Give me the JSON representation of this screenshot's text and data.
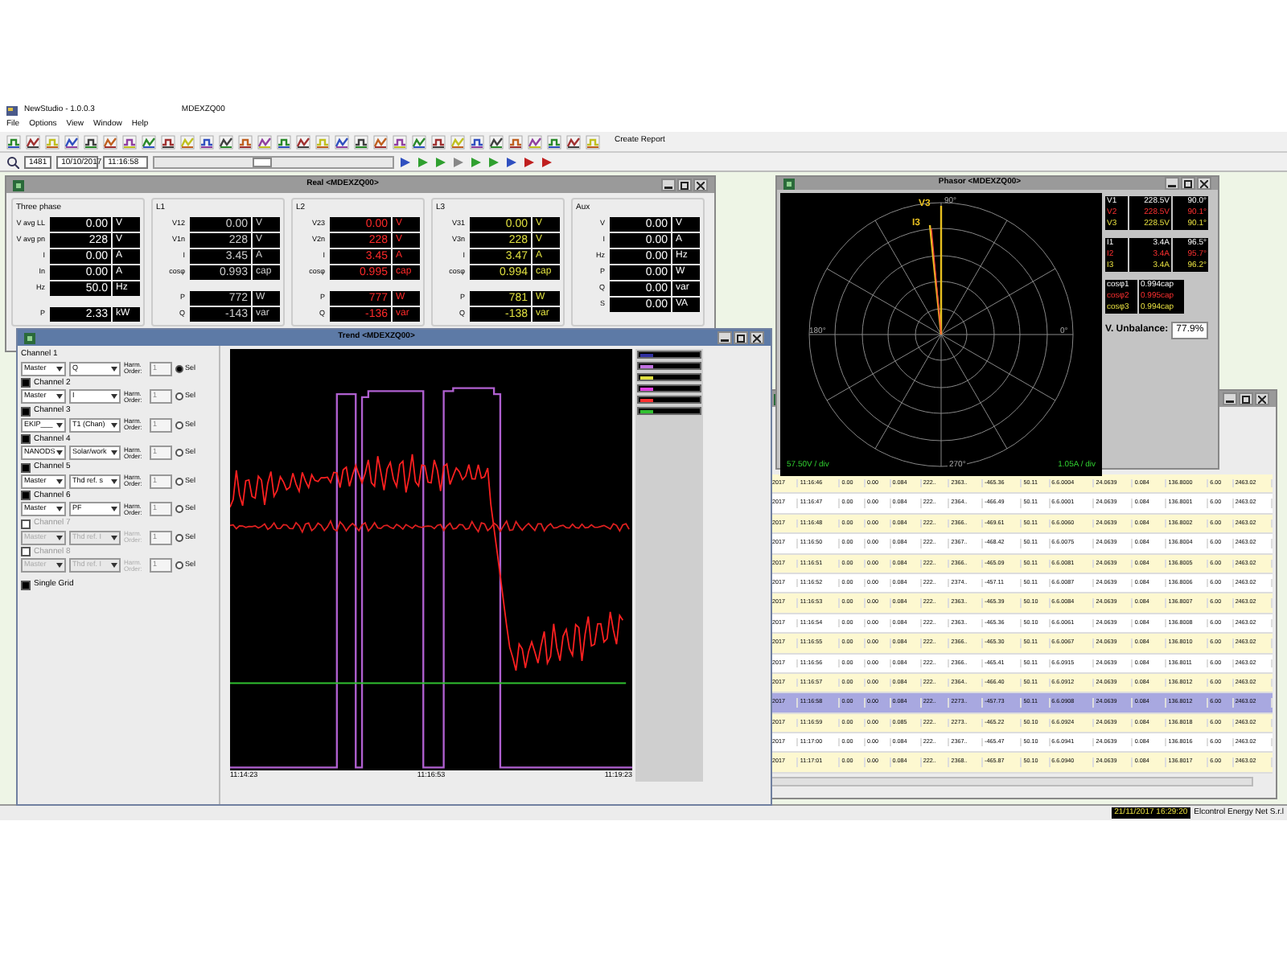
{
  "app": {
    "title": "NewStudio - 1.0.0.3",
    "device": "MDEXZQ00"
  },
  "menu": [
    "File",
    "Options",
    "View",
    "Window",
    "Help"
  ],
  "toolbar": {
    "create_report": "Create Report"
  },
  "navigation": {
    "record": "1481",
    "date": "10/10/2017",
    "time": "11:16:58",
    "level": 0.45
  },
  "real_window": {
    "title": "Real <MDEXZQ00>",
    "groups": [
      {
        "title": "Three phase",
        "kind": "total",
        "blocks": [
          [
            {
              "label": "V avg LL",
              "value": "0.00",
              "unit": "V"
            },
            {
              "label": "V avg pn",
              "value": "228",
              "unit": "V"
            },
            {
              "label": "I",
              "value": "0.00",
              "unit": "A"
            },
            {
              "label": "In",
              "value": "0.00",
              "unit": "A"
            },
            {
              "label": "Hz",
              "value": "50.0",
              "unit": "Hz"
            }
          ],
          [
            {
              "label": "P",
              "value": "2.33",
              "unit": "kW"
            }
          ]
        ]
      },
      {
        "title": "L1",
        "kind": "l1",
        "blocks": [
          [
            {
              "label": "V12",
              "value": "0.00",
              "unit": "V"
            },
            {
              "label": "V1n",
              "value": "228",
              "unit": "V"
            },
            {
              "label": "I",
              "value": "3.45",
              "unit": "A"
            },
            {
              "label": "cosφ",
              "value": "0.993",
              "unit": "cap"
            }
          ],
          [
            {
              "label": "P",
              "value": "772",
              "unit": "W"
            },
            {
              "label": "Q",
              "value": "-143",
              "unit": "var"
            }
          ]
        ]
      },
      {
        "title": "L2",
        "kind": "l2",
        "blocks": [
          [
            {
              "label": "V23",
              "value": "0.00",
              "unit": "V"
            },
            {
              "label": "V2n",
              "value": "228",
              "unit": "V"
            },
            {
              "label": "I",
              "value": "3.45",
              "unit": "A"
            },
            {
              "label": "cosφ",
              "value": "0.995",
              "unit": "cap"
            }
          ],
          [
            {
              "label": "P",
              "value": "777",
              "unit": "W"
            },
            {
              "label": "Q",
              "value": "-136",
              "unit": "var"
            }
          ]
        ]
      },
      {
        "title": "L3",
        "kind": "l3",
        "blocks": [
          [
            {
              "label": "V31",
              "value": "0.00",
              "unit": "V"
            },
            {
              "label": "V3n",
              "value": "228",
              "unit": "V"
            },
            {
              "label": "I",
              "value": "3.47",
              "unit": "A"
            },
            {
              "label": "cosφ",
              "value": "0.994",
              "unit": "cap"
            }
          ],
          [
            {
              "label": "P",
              "value": "781",
              "unit": "W"
            },
            {
              "label": "Q",
              "value": "-138",
              "unit": "var"
            }
          ]
        ]
      },
      {
        "title": "Aux",
        "kind": "aux",
        "blocks": [
          [
            {
              "label": "V",
              "value": "0.00",
              "unit": "V"
            },
            {
              "label": "I",
              "value": "0.00",
              "unit": "A"
            },
            {
              "label": "Hz",
              "value": "0.00",
              "unit": "Hz"
            },
            {
              "label": "P",
              "value": "0.00",
              "unit": "W"
            },
            {
              "label": "Q",
              "value": "0.00",
              "unit": "var"
            },
            {
              "label": "S",
              "value": "0.00",
              "unit": "VA"
            }
          ]
        ]
      }
    ]
  },
  "trend_window": {
    "title": "Trend <MDEXZQ00>",
    "channels": [
      {
        "kind": "plain",
        "label": "Channel 1",
        "disabled": false,
        "source": "Master",
        "quantity": "Q",
        "harm_label": "Harm. Order:",
        "order": "1",
        "sel_label": "Sel",
        "selected": true
      },
      {
        "kind": "checkbox",
        "label": "Channel 2",
        "checked": true,
        "disabled": false,
        "source": "Master",
        "quantity": "I",
        "harm_label": "Harm. Order:",
        "order": "1",
        "sel_label": "Sel",
        "selected": false
      },
      {
        "kind": "checkbox",
        "label": "Channel 3",
        "checked": true,
        "disabled": false,
        "source": "EKIP___",
        "quantity": "T1 (Chan)",
        "harm_label": "Harm. Order:",
        "order": "1",
        "sel_label": "Sel",
        "selected": false
      },
      {
        "kind": "checkbox",
        "label": "Channel 4",
        "checked": true,
        "disabled": false,
        "source": "NANODS",
        "quantity": "Solar/work",
        "harm_label": "Harm. Order:",
        "order": "1",
        "sel_label": "Sel",
        "selected": false
      },
      {
        "kind": "checkbox",
        "label": "Channel 5",
        "checked": true,
        "disabled": false,
        "source": "Master",
        "quantity": "Thd ref. s",
        "harm_label": "Harm. Order:",
        "order": "1",
        "sel_label": "Sel",
        "selected": false
      },
      {
        "kind": "checkbox",
        "label": "Channel 6",
        "checked": true,
        "disabled": false,
        "source": "Master",
        "quantity": "PF",
        "harm_label": "Harm. Order:",
        "order": "1",
        "sel_label": "Sel",
        "selected": false
      },
      {
        "kind": "checkbox",
        "label": "Channel 7",
        "checked": false,
        "disabled": true,
        "source": "Master",
        "quantity": "Thd ref. I",
        "harm_label": "Harm. Order:",
        "order": "1",
        "sel_label": "Sel",
        "selected": false
      },
      {
        "kind": "checkbox",
        "label": "Channel 8",
        "checked": false,
        "disabled": true,
        "source": "Master",
        "quantity": "Thd ref. I",
        "harm_label": "Harm. Order:",
        "order": "1",
        "sel_label": "Sel",
        "selected": false
      }
    ],
    "single_grid": {
      "label": "Single Grid",
      "checked": true
    },
    "time_labels": [
      "11:14:23",
      "11:16:53",
      "11:19:23"
    ],
    "legend": [
      {
        "color": "#3030a0"
      },
      {
        "color": "#c070e0"
      },
      {
        "color": "#e0e040"
      },
      {
        "color": "#e040e0"
      },
      {
        "color": "#ff3030"
      },
      {
        "color": "#30c030"
      }
    ]
  },
  "phasor_window": {
    "title": "Phasor <MDEXZQ00>",
    "angles": {
      "top": "90°",
      "left": "180°",
      "right": "0°",
      "bottom": "270°"
    },
    "vector_labels": [
      "V3",
      "I3"
    ],
    "scale_v": "57.50V / div",
    "scale_i": "1.05A / div",
    "voltages": [
      {
        "name": "V1",
        "value": "228.5V",
        "angle": "90.0°",
        "kind": "l1"
      },
      {
        "name": "V2",
        "value": "228.5V",
        "angle": "90.1°",
        "kind": "l2"
      },
      {
        "name": "V3",
        "value": "228.5V",
        "angle": "90.1°",
        "kind": "l3"
      }
    ],
    "currents": [
      {
        "name": "I1",
        "value": "3.4A",
        "angle": "96.5°",
        "kind": "l1"
      },
      {
        "name": "I2",
        "value": "3.4A",
        "angle": "95.7°",
        "kind": "l2"
      },
      {
        "name": "I3",
        "value": "3.4A",
        "angle": "96.2°",
        "kind": "l3"
      }
    ],
    "cos": [
      {
        "name": "cosφ1",
        "value": "0.994cap",
        "kind": "l1"
      },
      {
        "name": "cosφ2",
        "value": "0.995cap",
        "kind": "l2"
      },
      {
        "name": "cosφ3",
        "value": "0.994cap",
        "kind": "l3"
      }
    ],
    "unbalance": {
      "label": "V. Unbalance:",
      "value": "77.9%"
    }
  },
  "table_window": {
    "rows": [
      {
        "selected": false,
        "cells": [
          "2017",
          "11:16:46",
          "0.00",
          "0.00",
          "0.084",
          "222..",
          "2363..",
          "-465.36",
          "50.11",
          "6.6.0004",
          "24.0639",
          "0.084",
          "136.8000",
          "6.00",
          "2463.02"
        ]
      },
      {
        "selected": false,
        "cells": [
          "2017",
          "11:16:47",
          "0.00",
          "0.00",
          "0.084",
          "222..",
          "2364..",
          "-466.49",
          "50.11",
          "6.6.0001",
          "24.0639",
          "0.084",
          "136.8001",
          "6.00",
          "2463.02"
        ]
      },
      {
        "selected": false,
        "cells": [
          "2017",
          "11:16:48",
          "0.00",
          "0.00",
          "0.084",
          "222..",
          "2366..",
          "-469.61",
          "50.11",
          "6.6.0060",
          "24.0639",
          "0.084",
          "136.8002",
          "6.00",
          "2463.02"
        ]
      },
      {
        "selected": false,
        "cells": [
          "2017",
          "11:16:50",
          "0.00",
          "0.00",
          "0.084",
          "222..",
          "2367..",
          "-468.42",
          "50.11",
          "6.6.0075",
          "24.0639",
          "0.084",
          "136.8004",
          "6.00",
          "2463.02"
        ]
      },
      {
        "selected": false,
        "cells": [
          "2017",
          "11:16:51",
          "0.00",
          "0.00",
          "0.084",
          "222..",
          "2366..",
          "-465.09",
          "50.11",
          "6.6.0081",
          "24.0639",
          "0.084",
          "136.8005",
          "6.00",
          "2463.02"
        ]
      },
      {
        "selected": false,
        "cells": [
          "2017",
          "11:16:52",
          "0.00",
          "0.00",
          "0.084",
          "222..",
          "2374..",
          "-457.11",
          "50.11",
          "6.6.0087",
          "24.0639",
          "0.084",
          "136.8006",
          "6.00",
          "2463.02"
        ]
      },
      {
        "selected": false,
        "cells": [
          "2017",
          "11:16:53",
          "0.00",
          "0.00",
          "0.084",
          "222..",
          "2363..",
          "-465.39",
          "50.10",
          "6.6.0084",
          "24.0639",
          "0.084",
          "136.8007",
          "6.00",
          "2463.02"
        ]
      },
      {
        "selected": false,
        "cells": [
          "2017",
          "11:16:54",
          "0.00",
          "0.00",
          "0.084",
          "222..",
          "2363..",
          "-465.36",
          "50.10",
          "6.6.0061",
          "24.0639",
          "0.084",
          "136.8008",
          "6.00",
          "2463.02"
        ]
      },
      {
        "selected": false,
        "cells": [
          "2017",
          "11:16:55",
          "0.00",
          "0.00",
          "0.084",
          "222..",
          "2366..",
          "-465.30",
          "50.11",
          "6.6.0067",
          "24.0639",
          "0.084",
          "136.8010",
          "6.00",
          "2463.02"
        ]
      },
      {
        "selected": false,
        "cells": [
          "2017",
          "11:16:56",
          "0.00",
          "0.00",
          "0.084",
          "222..",
          "2366..",
          "-465.41",
          "50.11",
          "6.6.0915",
          "24.0639",
          "0.084",
          "136.8011",
          "6.00",
          "2463.02"
        ]
      },
      {
        "selected": false,
        "cells": [
          "2017",
          "11:16:57",
          "0.00",
          "0.00",
          "0.084",
          "222..",
          "2364..",
          "-466.40",
          "50.11",
          "6.6.0912",
          "24.0639",
          "0.084",
          "136.8012",
          "6.00",
          "2463.02"
        ]
      },
      {
        "selected": true,
        "cells": [
          "2017",
          "11:16:58",
          "0.00",
          "0.00",
          "0.084",
          "222..",
          "2273..",
          "-457.73",
          "50.11",
          "6.6.0908",
          "24.0639",
          "0.084",
          "136.8012",
          "6.00",
          "2463.02"
        ]
      },
      {
        "selected": false,
        "cells": [
          "2017",
          "11:16:59",
          "0.00",
          "0.00",
          "0.085",
          "222..",
          "2273..",
          "-465.22",
          "50.10",
          "6.6.0924",
          "24.0639",
          "0.084",
          "136.8018",
          "6.00",
          "2463.02"
        ]
      },
      {
        "selected": false,
        "cells": [
          "2017",
          "11:17:00",
          "0.00",
          "0.00",
          "0.084",
          "222..",
          "2367..",
          "-465.47",
          "50.10",
          "6.6.0941",
          "24.0639",
          "0.084",
          "136.8016",
          "6.00",
          "2463.02"
        ]
      },
      {
        "selected": false,
        "cells": [
          "2017",
          "11:17:01",
          "0.00",
          "0.00",
          "0.084",
          "222..",
          "2368..",
          "-465.87",
          "50.10",
          "6.6.0940",
          "24.0639",
          "0.084",
          "136.8017",
          "6.00",
          "2463.02"
        ]
      }
    ]
  },
  "status_bar": {
    "datetime": "21/11/2017 16:29:20",
    "company": "Elcontrol Energy Net S.r.l"
  }
}
